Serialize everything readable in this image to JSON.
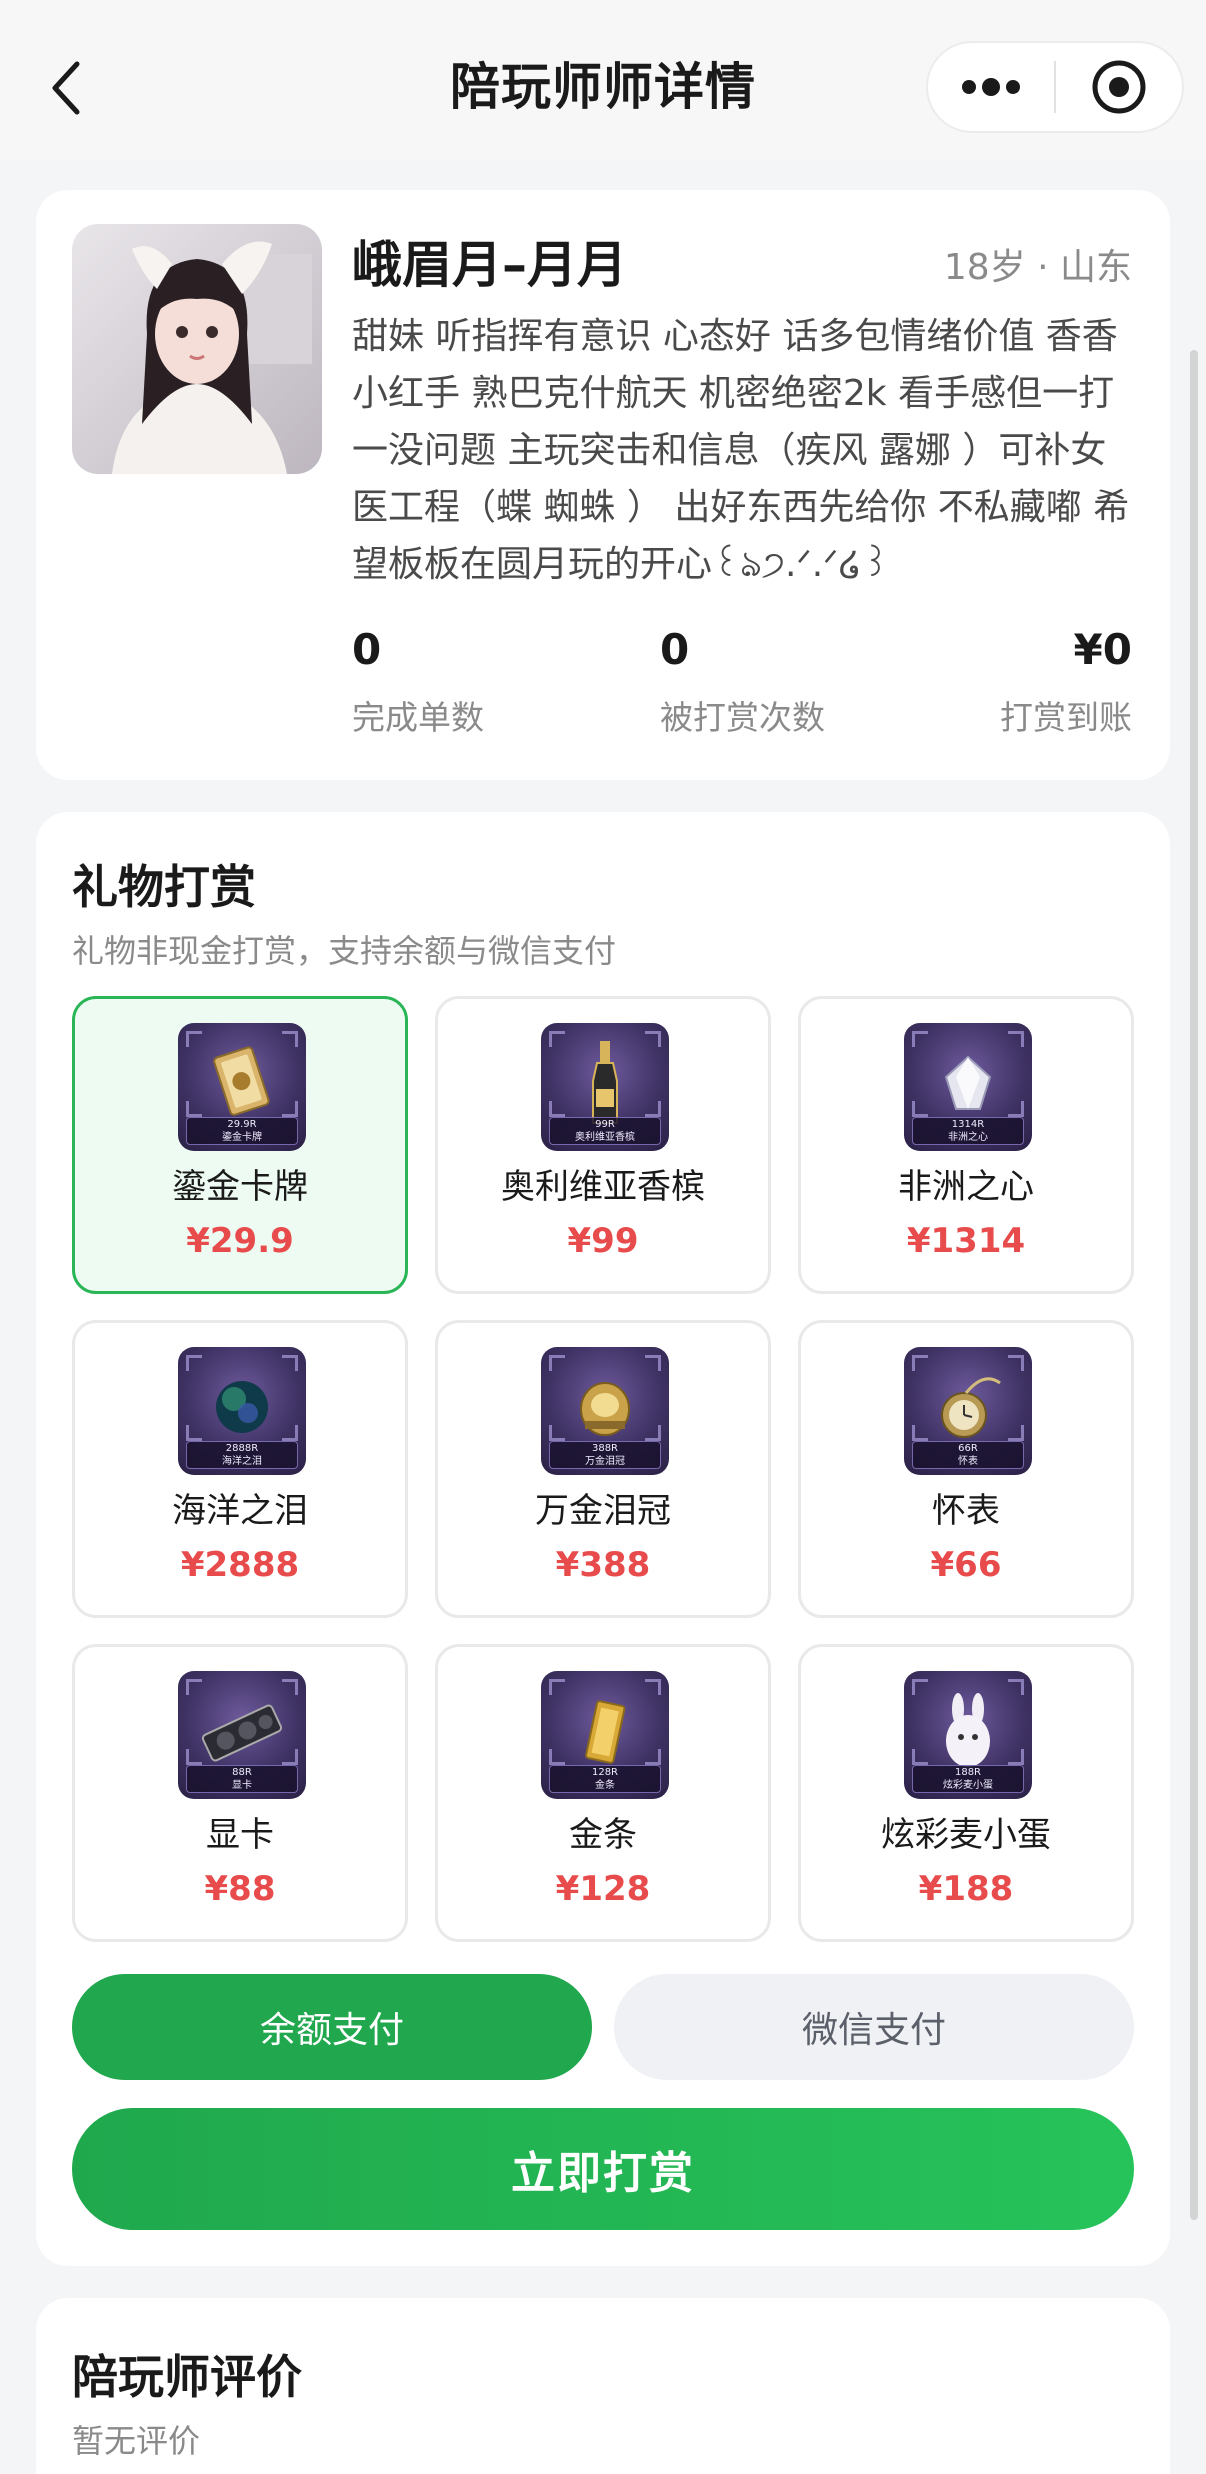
{
  "nav": {
    "title": "陪玩师师详情",
    "back_icon": "chevron-left-icon",
    "more_icon": "more-dots-icon",
    "close_icon": "target-close-icon"
  },
  "profile": {
    "name": "峨眉月–月月",
    "meta": "18岁 · 山东",
    "bio": "甜妹 听指挥有意识 心态好 话多包情绪价值 香香小红手 熟巴克什航天 机密绝密2k 看手感但一打一没问题 主玩突击和信息（疾风 露娜 ）可补女医工程（蝶 蜘蛛 ） 出好东西先给你 不私藏嘟 希望板板在圆月玩的开心꒰ঌ੭.ᐟ.ᐟ໒꒱",
    "stats": [
      {
        "value": "0",
        "label": "完成单数"
      },
      {
        "value": "0",
        "label": "被打赏次数"
      },
      {
        "value": "¥0",
        "label": "打赏到账"
      }
    ]
  },
  "gifts": {
    "title": "礼物打赏",
    "subtitle": "礼物非现金打赏，支持余额与微信支付",
    "selected_index": 0,
    "items": [
      {
        "name": "鎏金卡牌",
        "price": "¥29.9",
        "tag_price": "29.9R",
        "tag_name": "鎏金卡牌",
        "icon": "gold-card-icon"
      },
      {
        "name": "奥利维亚香槟",
        "price": "¥99",
        "tag_price": "99R",
        "tag_name": "奥利维亚香槟",
        "icon": "champagne-icon"
      },
      {
        "name": "非洲之心",
        "price": "¥1314",
        "tag_price": "1314R",
        "tag_name": "非洲之心",
        "icon": "diamond-icon"
      },
      {
        "name": "海洋之泪",
        "price": "¥2888",
        "tag_price": "2888R",
        "tag_name": "海洋之泪",
        "icon": "ocean-orb-icon"
      },
      {
        "name": "万金泪冠",
        "price": "¥388",
        "tag_price": "388R",
        "tag_name": "万金泪冠",
        "icon": "crown-icon"
      },
      {
        "name": "怀表",
        "price": "¥66",
        "tag_price": "66R",
        "tag_name": "怀表",
        "icon": "pocket-watch-icon"
      },
      {
        "name": "显卡",
        "price": "¥88",
        "tag_price": "88R",
        "tag_name": "显卡",
        "icon": "graphics-card-icon"
      },
      {
        "name": "金条",
        "price": "¥128",
        "tag_price": "128R",
        "tag_name": "金条",
        "icon": "gold-bar-icon"
      },
      {
        "name": "炫彩麦小蛋",
        "price": "¥188",
        "tag_price": "188R",
        "tag_name": "炫彩麦小蛋",
        "icon": "bunny-egg-icon"
      }
    ],
    "pay_balance": "余额支付",
    "pay_wechat": "微信支付",
    "submit": "立即打赏"
  },
  "reviews": {
    "title": "陪玩师评价",
    "empty": "暂无评价"
  },
  "colors": {
    "accent_green": "#21a74d",
    "price_red": "#e84b4b",
    "selected_bg": "#eefbf2"
  }
}
